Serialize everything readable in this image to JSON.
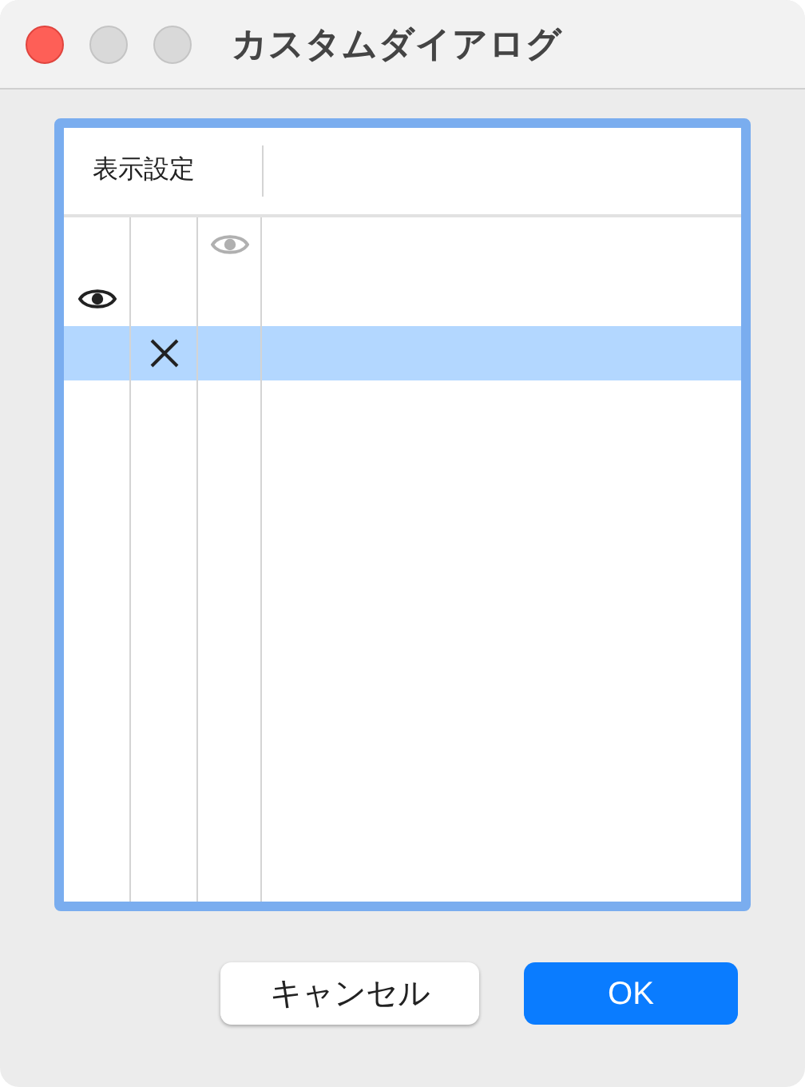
{
  "window": {
    "title": "カスタムダイアログ"
  },
  "table": {
    "columns": [
      {
        "label": "表示設定"
      }
    ],
    "rows": [
      {
        "selected": false,
        "cells": [
          {
            "kind": "empty"
          },
          {
            "kind": "empty"
          },
          {
            "kind": "eye",
            "disabled": true
          }
        ]
      },
      {
        "selected": false,
        "cells": [
          {
            "kind": "eye",
            "disabled": false
          },
          {
            "kind": "empty"
          },
          {
            "kind": "empty"
          }
        ]
      },
      {
        "selected": true,
        "cells": [
          {
            "kind": "empty"
          },
          {
            "kind": "cross"
          },
          {
            "kind": "empty"
          }
        ]
      }
    ]
  },
  "buttons": [
    {
      "label": "キャンセル",
      "kind": "secondary"
    },
    {
      "label": "OK",
      "kind": "primary"
    }
  ]
}
